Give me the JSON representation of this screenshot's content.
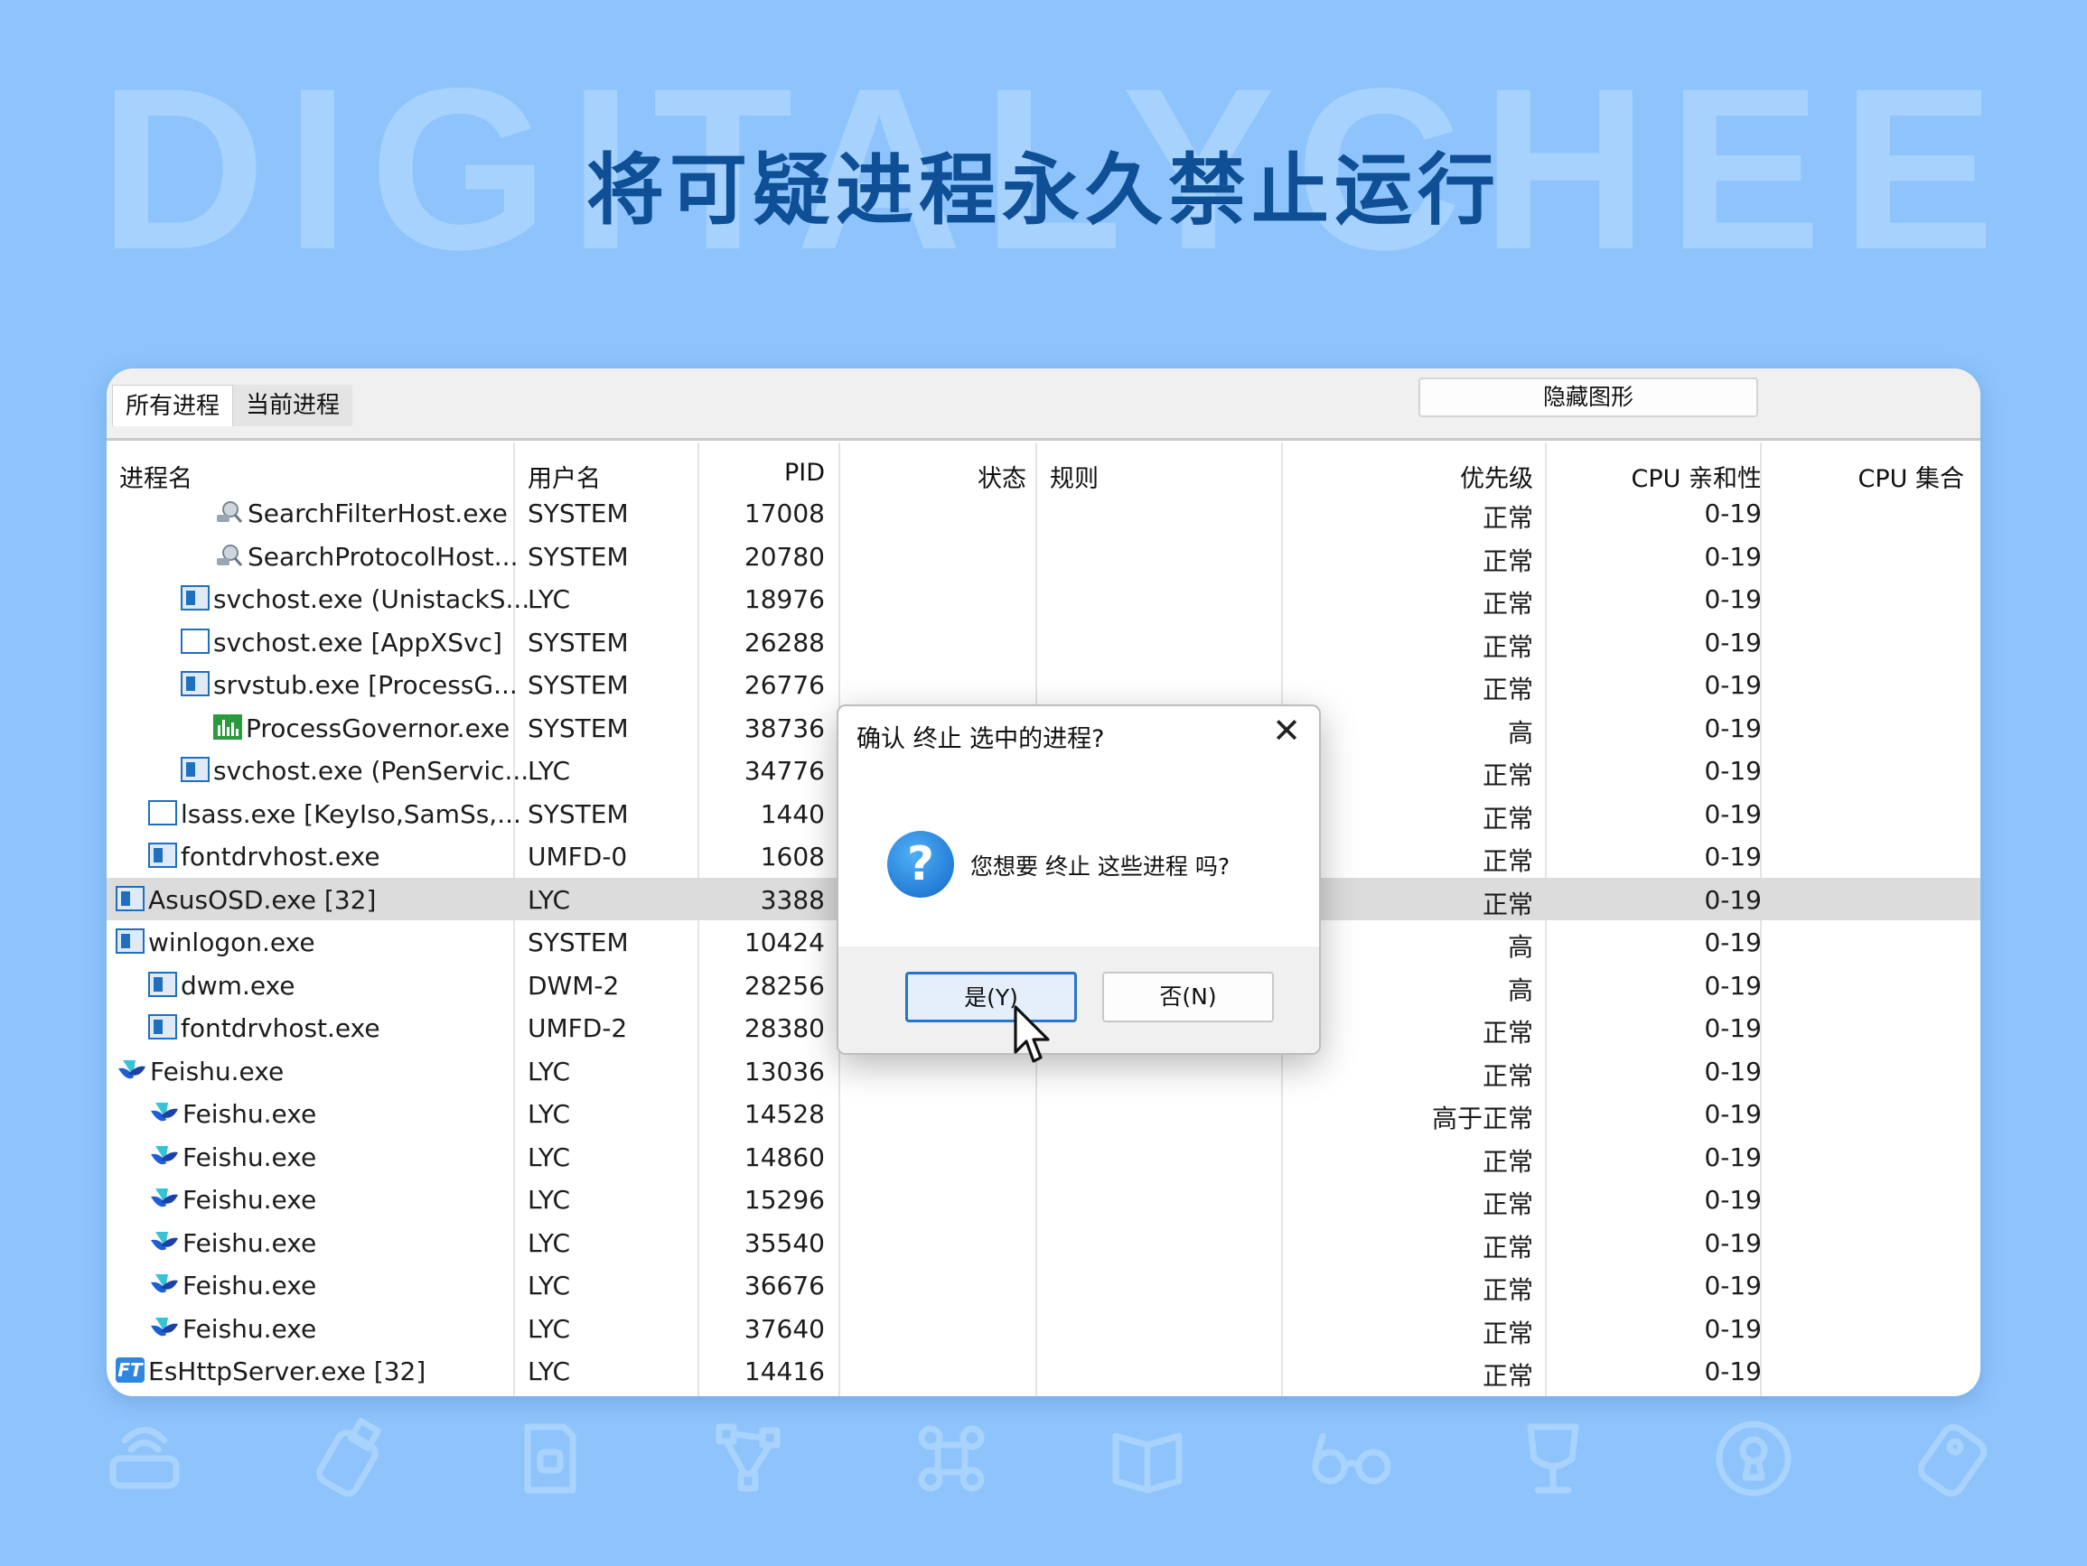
{
  "background_text": "DIGITALYCHEE",
  "headline": "将可疑进程永久禁止运行",
  "tabs": [
    {
      "label": "所有进程"
    },
    {
      "label": "当前进程"
    }
  ],
  "hide_graph_button": "隐藏图形",
  "columns": {
    "name": "进程名",
    "user": "用户名",
    "pid": "PID",
    "status": "状态",
    "rule": "规则",
    "priority": "优先级",
    "cpu_affinity": "CPU 亲和性",
    "cpu_set": "CPU 集合"
  },
  "rows": [
    {
      "name": "SearchFilterHost.exe",
      "user": "SYSTEM",
      "pid": "17008",
      "priority": "正常",
      "affinity": "0-19",
      "icon": "search-host-icon",
      "indent": 3
    },
    {
      "name": "SearchProtocolHost...",
      "user": "SYSTEM",
      "pid": "20780",
      "priority": "正常",
      "affinity": "0-19",
      "icon": "search-host-icon",
      "indent": 3
    },
    {
      "name": "svchost.exe (UnistackS...",
      "user": "LYC",
      "pid": "18976",
      "priority": "正常",
      "affinity": "0-19",
      "icon": "window-icon",
      "indent": 2
    },
    {
      "name": "svchost.exe [AppXSvc]",
      "user": "SYSTEM",
      "pid": "26288",
      "priority": "正常",
      "affinity": "0-19",
      "icon": "empty-window-icon",
      "indent": 2
    },
    {
      "name": "srvstub.exe [ProcessG...",
      "user": "SYSTEM",
      "pid": "26776",
      "priority": "正常",
      "affinity": "0-19",
      "icon": "window-icon",
      "indent": 2
    },
    {
      "name": "ProcessGovernor.exe",
      "user": "SYSTEM",
      "pid": "38736",
      "priority": "高",
      "affinity": "0-19",
      "icon": "process-governor-icon",
      "indent": 3
    },
    {
      "name": "svchost.exe (PenServic...",
      "user": "LYC",
      "pid": "34776",
      "priority": "正常",
      "affinity": "0-19",
      "icon": "window-icon",
      "indent": 2
    },
    {
      "name": "lsass.exe [KeyIso,SamSs,...",
      "user": "SYSTEM",
      "pid": "1440",
      "priority": "正常",
      "affinity": "0-19",
      "icon": "empty-window-icon",
      "indent": 1
    },
    {
      "name": "fontdrvhost.exe",
      "user": "UMFD-0",
      "pid": "1608",
      "priority": "正常",
      "affinity": "0-19",
      "icon": "window-icon",
      "indent": 1
    },
    {
      "name": "AsusOSD.exe [32]",
      "user": "LYC",
      "pid": "3388",
      "priority": "正常",
      "affinity": "0-19",
      "icon": "window-icon",
      "indent": 0,
      "selected": true
    },
    {
      "name": "winlogon.exe",
      "user": "SYSTEM",
      "pid": "10424",
      "priority": "高",
      "affinity": "0-19",
      "icon": "window-icon",
      "indent": 0
    },
    {
      "name": "dwm.exe",
      "user": "DWM-2",
      "pid": "28256",
      "priority": "高",
      "affinity": "0-19",
      "icon": "window-icon",
      "indent": 1
    },
    {
      "name": "fontdrvhost.exe",
      "user": "UMFD-2",
      "pid": "28380",
      "priority": "正常",
      "affinity": "0-19",
      "icon": "window-icon",
      "indent": 1
    },
    {
      "name": "Feishu.exe",
      "user": "LYC",
      "pid": "13036",
      "priority": "正常",
      "affinity": "0-19",
      "icon": "feishu-icon",
      "indent": 0
    },
    {
      "name": "Feishu.exe",
      "user": "LYC",
      "pid": "14528",
      "priority": "高于正常",
      "affinity": "0-19",
      "icon": "feishu-icon",
      "indent": 1
    },
    {
      "name": "Feishu.exe",
      "user": "LYC",
      "pid": "14860",
      "priority": "正常",
      "affinity": "0-19",
      "icon": "feishu-icon",
      "indent": 1
    },
    {
      "name": "Feishu.exe",
      "user": "LYC",
      "pid": "15296",
      "priority": "正常",
      "affinity": "0-19",
      "icon": "feishu-icon",
      "indent": 1
    },
    {
      "name": "Feishu.exe",
      "user": "LYC",
      "pid": "35540",
      "priority": "正常",
      "affinity": "0-19",
      "icon": "feishu-icon",
      "indent": 1
    },
    {
      "name": "Feishu.exe",
      "user": "LYC",
      "pid": "36676",
      "priority": "正常",
      "affinity": "0-19",
      "icon": "feishu-icon",
      "indent": 1
    },
    {
      "name": "Feishu.exe",
      "user": "LYC",
      "pid": "37640",
      "priority": "正常",
      "affinity": "0-19",
      "icon": "feishu-icon",
      "indent": 1
    },
    {
      "name": "EsHttpServer.exe [32]",
      "user": "LYC",
      "pid": "14416",
      "priority": "正常",
      "affinity": "0-19",
      "icon": "ft-icon",
      "indent": 0
    }
  ],
  "dialog": {
    "title": "确认 终止 选中的进程?",
    "message": "您想要 终止 这些进程 吗?",
    "yes_label": "是(Y)",
    "no_label": "否(N)",
    "icon": "question-icon"
  },
  "bottom_icons": [
    "router-icon",
    "usb-drive-icon",
    "sd-card-icon",
    "vector-node-icon",
    "command-key-icon",
    "book-icon",
    "glasses-icon",
    "trophy-icon",
    "keyhole-icon",
    "tag-icon"
  ],
  "colors": {
    "background": "#8ec4fb",
    "headline": "#0e4f96",
    "selected_row": "#dcdcdc",
    "accent": "#2a74c8"
  }
}
